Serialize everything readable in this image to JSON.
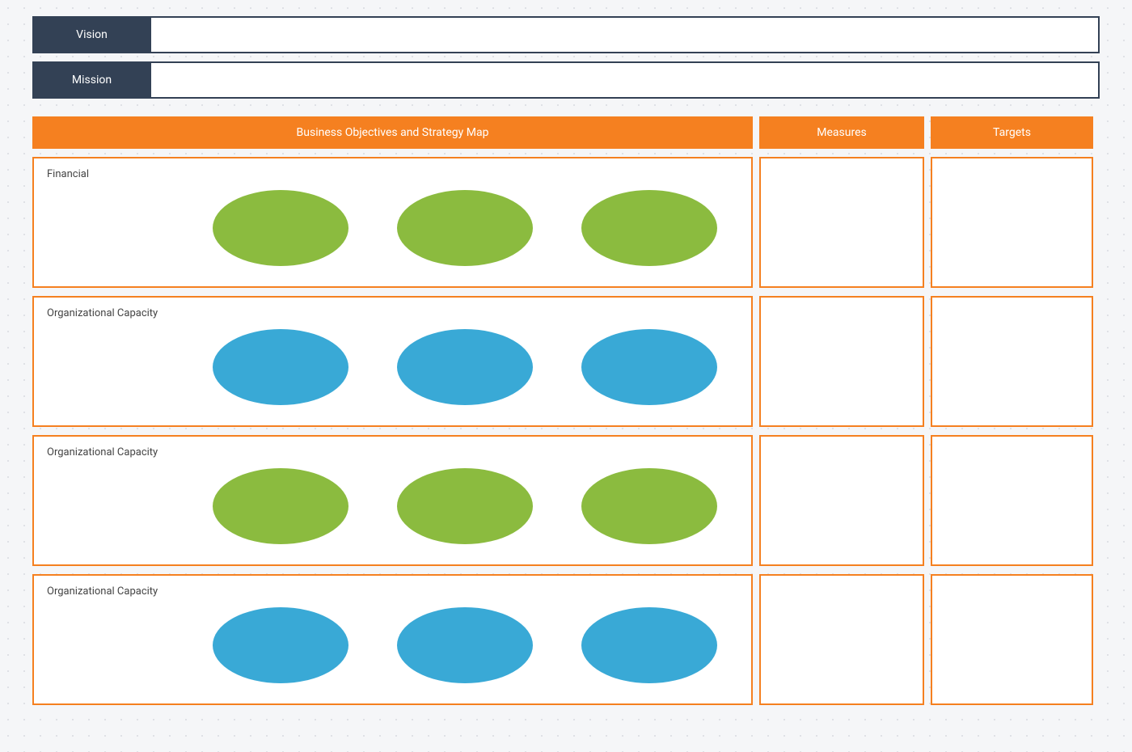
{
  "vision": {
    "label": "Vision",
    "value": ""
  },
  "mission": {
    "label": "Mission",
    "value": ""
  },
  "columns": {
    "main": "Business Objectives and Strategy Map",
    "measures": "Measures",
    "targets": "Targets"
  },
  "colors": {
    "green": "#8bbb3f",
    "blue": "#39a9d6",
    "orange": "#f58020",
    "navy": "#334155"
  },
  "rows": [
    {
      "perspective": "Financial",
      "ellipseColor": "green",
      "ellipseCount": 3,
      "measures": "",
      "targets": ""
    },
    {
      "perspective": "Organizational Capacity",
      "ellipseColor": "blue",
      "ellipseCount": 3,
      "measures": "",
      "targets": ""
    },
    {
      "perspective": "Organizational Capacity",
      "ellipseColor": "green",
      "ellipseCount": 3,
      "measures": "",
      "targets": ""
    },
    {
      "perspective": "Organizational Capacity",
      "ellipseColor": "blue",
      "ellipseCount": 3,
      "measures": "",
      "targets": ""
    }
  ]
}
